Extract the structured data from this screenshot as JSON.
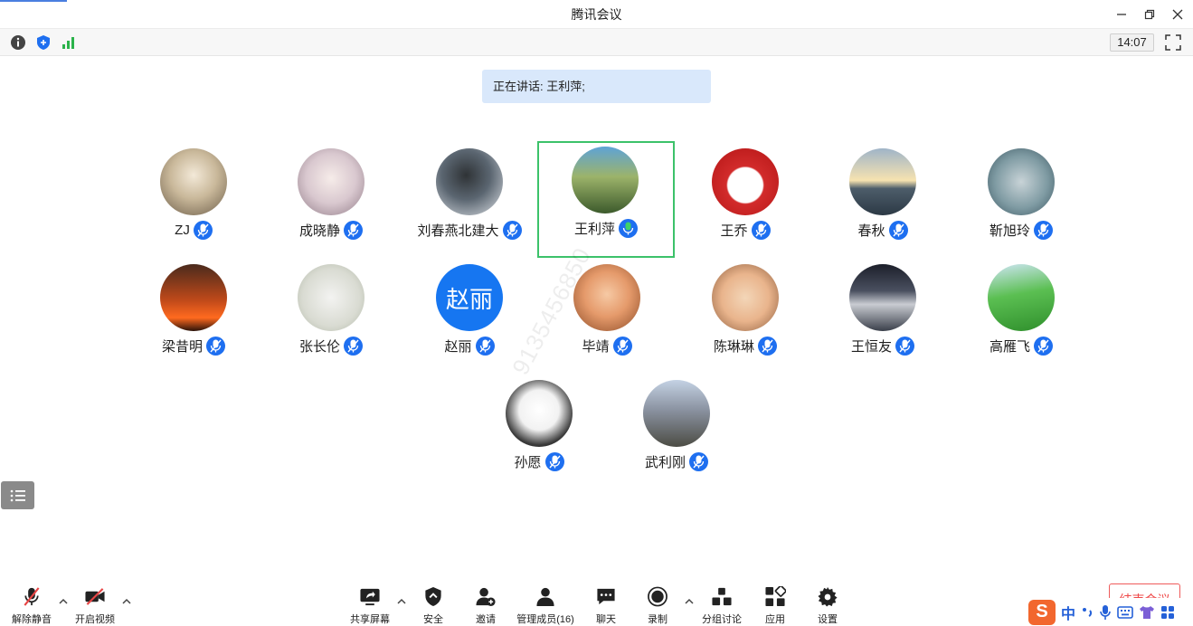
{
  "window": {
    "title": "腾讯会议"
  },
  "infobar": {
    "time": "14:07"
  },
  "speaking": {
    "text": "正在讲话: 王利萍;"
  },
  "participants": [
    {
      "name": "ZJ"
    },
    {
      "name": "成晓静"
    },
    {
      "name": "刘春燕北建大"
    },
    {
      "name": "王利萍"
    },
    {
      "name": "王乔"
    },
    {
      "name": "春秋"
    },
    {
      "name": "靳旭玲"
    },
    {
      "name": "梁昔明"
    },
    {
      "name": "张长伦"
    },
    {
      "name": "赵丽",
      "avatar_text": "赵丽"
    },
    {
      "name": "毕靖"
    },
    {
      "name": "陈琳琳"
    },
    {
      "name": "王恒友"
    },
    {
      "name": "高雁飞"
    },
    {
      "name": "孙愿"
    },
    {
      "name": "武利刚"
    }
  ],
  "watermark": "9135456850",
  "toolbar": {
    "unmute": "解除静音",
    "start_video": "开启视频",
    "share_screen": "共享屏幕",
    "security": "安全",
    "invite": "邀请",
    "manage_members": "管理成员(16)",
    "chat": "聊天",
    "record": "录制",
    "breakout": "分组讨论",
    "apps": "应用",
    "settings": "设置",
    "end_meeting": "结束会议"
  },
  "ime": {
    "logo": "S",
    "mode": "中"
  },
  "colors": {
    "accent": "#1e6ff0",
    "active_border": "#3cc26a",
    "banner": "#d9e8fb",
    "danger": "#ef4a4a"
  }
}
